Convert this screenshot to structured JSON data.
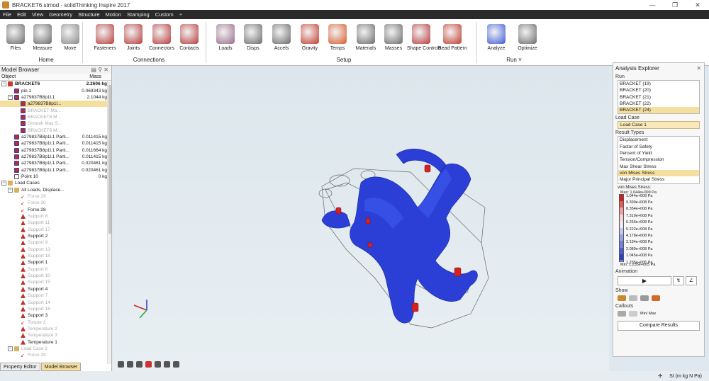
{
  "window": {
    "title": "BRACKET6.stmod - solidThinking Inspire 2017",
    "minimize": "—",
    "restore": "❐",
    "close": "✕"
  },
  "menu": [
    "File",
    "Edit",
    "View",
    "Geometry",
    "Structure",
    "Motion",
    "Stamping",
    "Custom"
  ],
  "menu_active": "Structure",
  "menu_add": "+",
  "ribbon": {
    "tools": [
      {
        "id": "files",
        "label": "Files"
      },
      {
        "id": "measure",
        "label": "Measure"
      },
      {
        "id": "move",
        "label": "Move"
      },
      {
        "id": "fasteners",
        "label": "Fasteners"
      },
      {
        "id": "joints",
        "label": "Joints"
      },
      {
        "id": "connectors",
        "label": "Connectors"
      },
      {
        "id": "contacts",
        "label": "Contacts"
      },
      {
        "id": "loads",
        "label": "Loads"
      },
      {
        "id": "disps",
        "label": "Disps"
      },
      {
        "id": "accels",
        "label": "Accels"
      },
      {
        "id": "gravity",
        "label": "Gravity"
      },
      {
        "id": "temps",
        "label": "Temps"
      },
      {
        "id": "materials",
        "label": "Materials"
      },
      {
        "id": "masses",
        "label": "Masses"
      },
      {
        "id": "shapecontrols",
        "label": "Shape Controls"
      },
      {
        "id": "beadpattern",
        "label": "Bead Pattern"
      },
      {
        "id": "analyze",
        "label": "Analyze"
      },
      {
        "id": "optimize",
        "label": "Optimize"
      }
    ],
    "groups": {
      "home": "Home",
      "connections": "Connections",
      "setup": "Setup",
      "run": "Run ˅"
    }
  },
  "model_browser": {
    "title": "Model Browser",
    "col_object": "Object",
    "col_mass": "Mass",
    "rows": [
      {
        "name": "BRACKET6",
        "mass": "2.2606 kg",
        "lvl": 0,
        "exp": "−",
        "icon": "ic-body",
        "bold": true
      },
      {
        "name": "pin.1",
        "mass": "0.069343 kg",
        "lvl": 1,
        "icon": "ic-part"
      },
      {
        "name": "a279837B8p1l.1",
        "mass": "2.1044 kg",
        "lvl": 1,
        "exp": "−",
        "icon": "ic-part"
      },
      {
        "name": "a279837B8p1l...",
        "mass": "",
        "lvl": 2,
        "icon": "ic-part",
        "sel": true
      },
      {
        "name": "BRACKET Ma...",
        "mass": "",
        "lvl": 2,
        "icon": "ic-part",
        "dim": true
      },
      {
        "name": "BRACKET6 M...",
        "mass": "",
        "lvl": 2,
        "icon": "ic-part",
        "dim": true
      },
      {
        "name": "Smooth Max S...",
        "mass": "",
        "lvl": 2,
        "icon": "ic-part",
        "dim": true
      },
      {
        "name": "BRACKET6 M...",
        "mass": "",
        "lvl": 2,
        "icon": "ic-part",
        "dim": true
      },
      {
        "name": "a279837B8p1l.1 Parti...",
        "mass": "0.011415 kg",
        "lvl": 1,
        "icon": "ic-part"
      },
      {
        "name": "a279837B8p1l.1 Parti...",
        "mass": "0.011415 kg",
        "lvl": 1,
        "icon": "ic-part"
      },
      {
        "name": "a279837B8p1l.1 Parti...",
        "mass": "0.011664 kg",
        "lvl": 1,
        "icon": "ic-part"
      },
      {
        "name": "a279837B8p1l.1 Parti...",
        "mass": "0.011415 kg",
        "lvl": 1,
        "icon": "ic-part"
      },
      {
        "name": "a279837B8p1l.1 Parti...",
        "mass": "0.020461 kg",
        "lvl": 1,
        "icon": "ic-part"
      },
      {
        "name": "a279837B8p1l.1 Parti...",
        "mass": "0.020461 kg",
        "lvl": 1,
        "icon": "ic-part"
      },
      {
        "name": "Point 10",
        "mass": "0 kg",
        "lvl": 1,
        "icon": "ic-point"
      },
      {
        "name": "Load Cases",
        "mass": "",
        "lvl": 0,
        "exp": "−",
        "icon": "ic-folder"
      },
      {
        "name": "All Loads, Displace...",
        "mass": "",
        "lvl": 1,
        "exp": "−",
        "icon": "ic-folder"
      },
      {
        "name": "Force 29",
        "mass": "",
        "lvl": 2,
        "icon": "ic-force",
        "dim": true
      },
      {
        "name": "Force 30",
        "mass": "",
        "lvl": 2,
        "icon": "ic-force",
        "dim": true
      },
      {
        "name": "Force 28",
        "mass": "",
        "lvl": 2,
        "icon": "ic-force"
      },
      {
        "name": "Support 8",
        "mass": "",
        "lvl": 2,
        "icon": "ic-sup",
        "dim": true
      },
      {
        "name": "Support 11",
        "mass": "",
        "lvl": 2,
        "icon": "ic-sup",
        "dim": true
      },
      {
        "name": "Support 17",
        "mass": "",
        "lvl": 2,
        "icon": "ic-sup",
        "dim": true
      },
      {
        "name": "Support 2",
        "mass": "",
        "lvl": 2,
        "icon": "ic-sup"
      },
      {
        "name": "Support 9",
        "mass": "",
        "lvl": 2,
        "icon": "ic-sup",
        "dim": true
      },
      {
        "name": "Support 13",
        "mass": "",
        "lvl": 2,
        "icon": "ic-sup",
        "dim": true
      },
      {
        "name": "Support 18",
        "mass": "",
        "lvl": 2,
        "icon": "ic-sup",
        "dim": true
      },
      {
        "name": "Support 1",
        "mass": "",
        "lvl": 2,
        "icon": "ic-sup"
      },
      {
        "name": "Support 6",
        "mass": "",
        "lvl": 2,
        "icon": "ic-sup",
        "dim": true
      },
      {
        "name": "Support 10",
        "mass": "",
        "lvl": 2,
        "icon": "ic-sup",
        "dim": true
      },
      {
        "name": "Support 15",
        "mass": "",
        "lvl": 2,
        "icon": "ic-sup",
        "dim": true
      },
      {
        "name": "Support 4",
        "mass": "",
        "lvl": 2,
        "icon": "ic-sup"
      },
      {
        "name": "Support 7",
        "mass": "",
        "lvl": 2,
        "icon": "ic-sup",
        "dim": true
      },
      {
        "name": "Support 14",
        "mass": "",
        "lvl": 2,
        "icon": "ic-sup",
        "dim": true
      },
      {
        "name": "Support 16",
        "mass": "",
        "lvl": 2,
        "icon": "ic-sup",
        "dim": true
      },
      {
        "name": "Support 3",
        "mass": "",
        "lvl": 2,
        "icon": "ic-sup"
      },
      {
        "name": "Torque 2",
        "mass": "",
        "lvl": 2,
        "icon": "ic-force",
        "dim": true
      },
      {
        "name": "Temperature 2",
        "mass": "",
        "lvl": 2,
        "icon": "ic-sup",
        "dim": true
      },
      {
        "name": "Temperature 3",
        "mass": "",
        "lvl": 2,
        "icon": "ic-sup",
        "dim": true
      },
      {
        "name": "Temperature 1",
        "mass": "",
        "lvl": 2,
        "icon": "ic-sup"
      },
      {
        "name": "Load Case 2",
        "mass": "",
        "lvl": 1,
        "exp": "−",
        "icon": "ic-folder",
        "dim": true
      },
      {
        "name": "Force 29",
        "mass": "",
        "lvl": 2,
        "icon": "ic-force",
        "dim": true
      }
    ],
    "tabs": [
      "Property Editor",
      "Model Browser"
    ],
    "active_tab": "Model Browser"
  },
  "analysis_explorer": {
    "title": "Analysis Explorer",
    "run_label": "Run",
    "runs": [
      "BRACKET (19)",
      "BRACKET (20)",
      "BRACKET (21)",
      "BRACKET (22)",
      "BRACKET (24)"
    ],
    "run_selected": "BRACKET (24)",
    "load_case_label": "Load Case",
    "load_case_value": "Load Case 1",
    "result_types_label": "Result Types",
    "result_types": [
      "Displacement",
      "Factor of Safety",
      "Percent of Yield",
      "Tension/Compression",
      "Max Shear Stress",
      "von Mises Stress",
      "Major Principal Stress"
    ],
    "result_selected": "von Mises Stress",
    "legend_title": "von Mises Stress:",
    "legend_max": "Max:  1.044e+009 Pa",
    "legend_values": [
      "1.044e+009 Pa",
      "9.399e+008 Pa",
      "8.354e+008 Pa",
      "7.310e+008 Pa",
      "6.266e+008 Pa",
      "5.222e+008 Pa",
      "4.178e+008 Pa",
      "3.134e+008 Pa",
      "2.089e+008 Pa",
      "1.045e+008 Pa",
      "1.235e+005 Pa"
    ],
    "legend_min": "Min:  1.235e+005 Pa",
    "animation_label": "Animation",
    "show_label": "Show",
    "callouts_label": "Callouts",
    "minmax_label": "Min/ Max",
    "compare_label": "Compare Results"
  },
  "status": {
    "units": "SI (m kg N Pa)"
  }
}
